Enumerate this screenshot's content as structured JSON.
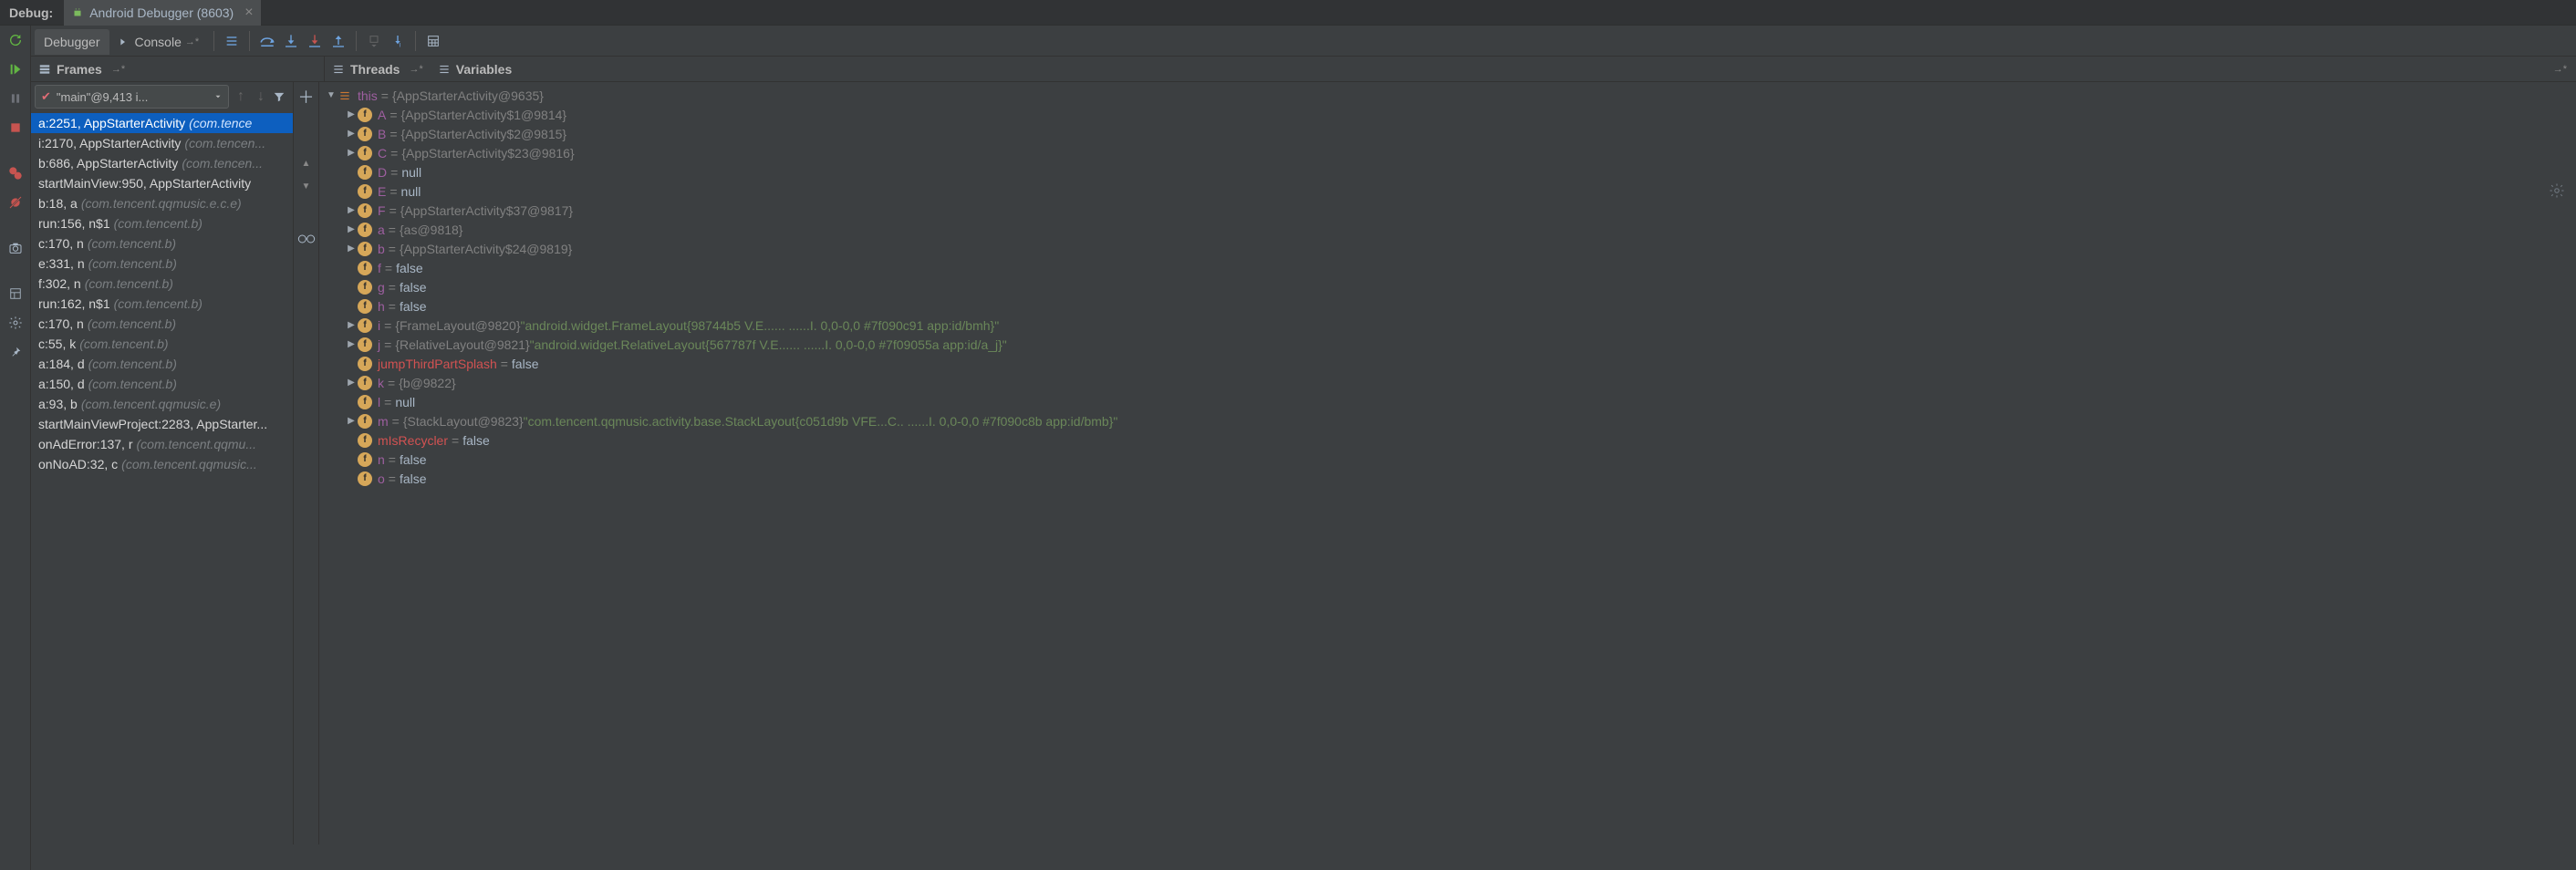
{
  "top": {
    "debug_label": "Debug:",
    "tab_label": "Android Debugger (8603)"
  },
  "toolbar": {
    "debugger_tab": "Debugger",
    "console_tab": "Console"
  },
  "panel_headers": {
    "frames": "Frames",
    "threads": "Threads",
    "variables": "Variables"
  },
  "frames": {
    "selected_thread": "\"main\"@9,413 i...",
    "items": [
      {
        "fn": "a:2251, AppStarterActivity",
        "pkg": "(com.tence",
        "selected": true
      },
      {
        "fn": "i:2170, AppStarterActivity",
        "pkg": "(com.tencen..."
      },
      {
        "fn": "b:686, AppStarterActivity",
        "pkg": "(com.tencen..."
      },
      {
        "fn": "startMainView:950, AppStarterActivity",
        "pkg": ""
      },
      {
        "fn": "b:18, a",
        "pkg": "(com.tencent.qqmusic.e.c.e)"
      },
      {
        "fn": "run:156, n$1",
        "pkg": "(com.tencent.b)"
      },
      {
        "fn": "c:170, n",
        "pkg": "(com.tencent.b)"
      },
      {
        "fn": "e:331, n",
        "pkg": "(com.tencent.b)"
      },
      {
        "fn": "f:302, n",
        "pkg": "(com.tencent.b)"
      },
      {
        "fn": "run:162, n$1",
        "pkg": "(com.tencent.b)"
      },
      {
        "fn": "c:170, n",
        "pkg": "(com.tencent.b)"
      },
      {
        "fn": "c:55, k",
        "pkg": "(com.tencent.b)"
      },
      {
        "fn": "a:184, d",
        "pkg": "(com.tencent.b)"
      },
      {
        "fn": "a:150, d",
        "pkg": "(com.tencent.b)"
      },
      {
        "fn": "a:93, b",
        "pkg": "(com.tencent.qqmusic.e)"
      },
      {
        "fn": "startMainViewProject:2283, AppStarter...",
        "pkg": ""
      },
      {
        "fn": "onAdError:137, r",
        "pkg": "(com.tencent.qqmu..."
      },
      {
        "fn": "onNoAD:32, c",
        "pkg": "(com.tencent.qqmusic..."
      }
    ]
  },
  "variables": {
    "root": {
      "name": "this",
      "val": "{AppStarterActivity@9635}"
    },
    "children": [
      {
        "arrow": true,
        "icon": "f",
        "name": "A",
        "val": "{AppStarterActivity$1@9814}",
        "vtype": "obj"
      },
      {
        "arrow": true,
        "icon": "f",
        "name": "B",
        "val": "{AppStarterActivity$2@9815}",
        "vtype": "obj"
      },
      {
        "arrow": true,
        "icon": "f",
        "name": "C",
        "val": "{AppStarterActivity$23@9816}",
        "vtype": "obj"
      },
      {
        "arrow": false,
        "icon": "f",
        "name": "D",
        "val": "null",
        "vtype": "plain"
      },
      {
        "arrow": false,
        "icon": "f",
        "name": "E",
        "val": "null",
        "vtype": "plain"
      },
      {
        "arrow": true,
        "icon": "f",
        "name": "F",
        "val": "{AppStarterActivity$37@9817}",
        "vtype": "obj"
      },
      {
        "arrow": true,
        "icon": "f",
        "name": "a",
        "val": "{as@9818}",
        "vtype": "obj"
      },
      {
        "arrow": true,
        "icon": "f",
        "name": "b",
        "val": "{AppStarterActivity$24@9819}",
        "vtype": "obj"
      },
      {
        "arrow": false,
        "icon": "f",
        "name": "f",
        "val": "false",
        "vtype": "plain"
      },
      {
        "arrow": false,
        "icon": "f",
        "name": "g",
        "val": "false",
        "vtype": "plain"
      },
      {
        "arrow": false,
        "icon": "f",
        "name": "h",
        "val": "false",
        "vtype": "plain"
      },
      {
        "arrow": true,
        "icon": "f",
        "name": "i",
        "val": "{FrameLayout@9820}",
        "vtype": "obj",
        "str": "\"android.widget.FrameLayout{98744b5 V.E...... ......I. 0,0-0,0 #7f090c91 app:id/bmh}\""
      },
      {
        "arrow": true,
        "icon": "f",
        "name": "j",
        "val": "{RelativeLayout@9821}",
        "vtype": "obj",
        "str": "\"android.widget.RelativeLayout{567787f V.E...... ......I. 0,0-0,0 #7f09055a app:id/a_j}\""
      },
      {
        "arrow": false,
        "icon": "f",
        "name": "jumpThirdPartSplash",
        "hot": true,
        "val": "false",
        "vtype": "plain"
      },
      {
        "arrow": true,
        "icon": "f",
        "name": "k",
        "val": "{b@9822}",
        "vtype": "obj"
      },
      {
        "arrow": false,
        "icon": "f",
        "name": "l",
        "val": "null",
        "vtype": "plain"
      },
      {
        "arrow": true,
        "icon": "f",
        "name": "m",
        "val": "{StackLayout@9823}",
        "vtype": "obj",
        "str": "\"com.tencent.qqmusic.activity.base.StackLayout{c051d9b VFE...C.. ......I. 0,0-0,0 #7f090c8b app:id/bmb}\""
      },
      {
        "arrow": false,
        "icon": "f",
        "name": "mIsRecycler",
        "hot": true,
        "val": "false",
        "vtype": "plain"
      },
      {
        "arrow": false,
        "icon": "f",
        "name": "n",
        "val": "false",
        "vtype": "plain"
      },
      {
        "arrow": false,
        "icon": "f",
        "name": "o",
        "val": "false",
        "vtype": "plain"
      }
    ]
  }
}
